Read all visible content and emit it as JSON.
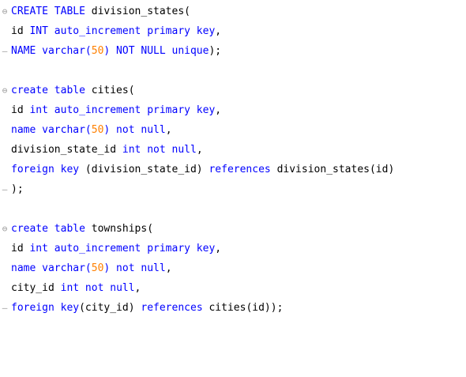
{
  "colors": {
    "keyword": "#0000ff",
    "number": "#ff8000",
    "identifier": "#000000",
    "fold_marker": "#9a9a9a"
  },
  "fold_markers": {
    "open": "⊖",
    "close": "–"
  },
  "code": {
    "l1": {
      "t1": "CREATE TABLE",
      "t2": " division_states("
    },
    "l2": {
      "t1": "id ",
      "t2": "INT auto_increment primary key",
      "t3": ","
    },
    "l3": {
      "t1": "NAME varchar(",
      "t2": "50",
      "t3": ") NOT NULL unique",
      "t4": ");"
    },
    "l4": {
      "t1": "create table",
      "t2": " cities("
    },
    "l5": {
      "t1": "id ",
      "t2": "int auto_increment primary key",
      "t3": ","
    },
    "l6": {
      "t1": "name varchar(",
      "t2": "50",
      "t3": ") not null",
      "t4": ","
    },
    "l7": {
      "t1": "division_state_id ",
      "t2": "int not null",
      "t3": ","
    },
    "l8": {
      "t1": "foreign key",
      "t2": " (division_state_id) ",
      "t3": "references",
      "t4": " division_states(id)"
    },
    "l9": {
      "t1": ");"
    },
    "l10": {
      "t1": "create table",
      "t2": " townships("
    },
    "l11": {
      "t1": "id ",
      "t2": "int auto_increment primary key",
      "t3": ","
    },
    "l12": {
      "t1": "name varchar(",
      "t2": "50",
      "t3": ") not null",
      "t4": ","
    },
    "l13": {
      "t1": "city_id ",
      "t2": "int not null",
      "t3": ","
    },
    "l14": {
      "t1": "foreign key",
      "t2": "(city_id) ",
      "t3": "references",
      "t4": " cities(id));"
    }
  }
}
